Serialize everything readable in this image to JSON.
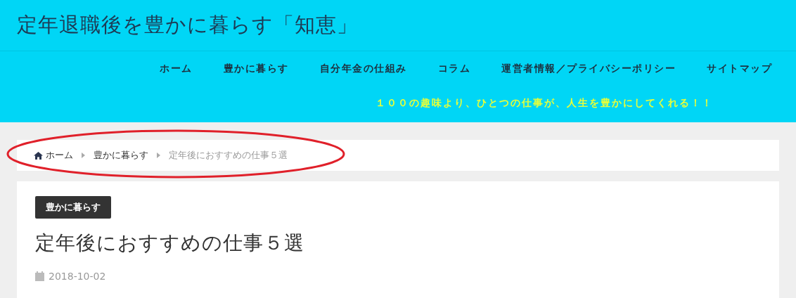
{
  "site_title": "定年退職後を豊かに暮らす「知恵」",
  "nav": [
    {
      "label": "ホーム"
    },
    {
      "label": "豊かに暮らす"
    },
    {
      "label": "自分年金の仕組み"
    },
    {
      "label": "コラム"
    },
    {
      "label": "運営者情報／プライバシーポリシー"
    },
    {
      "label": "サイトマップ"
    }
  ],
  "tagline": "１００の趣味より、ひとつの仕事が、人生を豊かにしてくれる！！",
  "breadcrumb": [
    {
      "label": "ホーム",
      "kind": "home"
    },
    {
      "label": "豊かに暮らす",
      "kind": "link"
    },
    {
      "label": "定年後におすすめの仕事５選",
      "kind": "current"
    }
  ],
  "article": {
    "category": "豊かに暮らす",
    "title": "定年後におすすめの仕事５選",
    "date": "2018-10-02"
  }
}
